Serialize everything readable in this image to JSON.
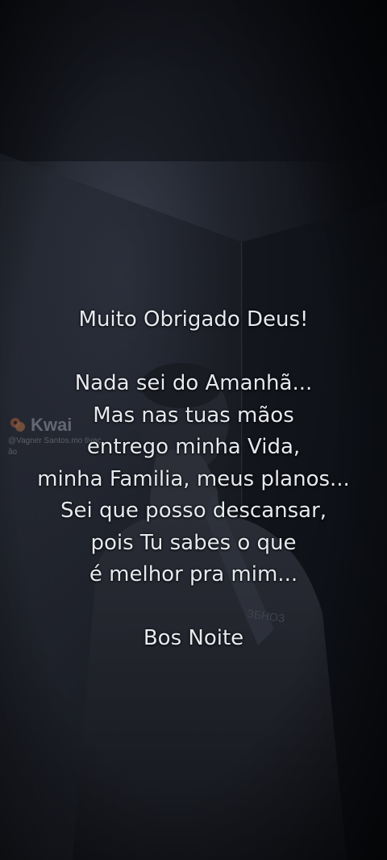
{
  "watermark": {
    "brand": "Kwai",
    "handle": "@Vagner Santos.mo tivação",
    "logo_icon": "kwai-logo-icon"
  },
  "quote": {
    "heading": "Muito Obrigado Deus!",
    "lines": [
      "Nada sei do Amanhã...",
      "Mas nas tuas mãos",
      "entrego minha Vida,",
      "minha Familia, meus planos...",
      "Sei que posso descansar,",
      "pois Tu sabes o que",
      "é melhor pra mim..."
    ],
    "closing": "Bos Noite"
  },
  "colors": {
    "background": "#0e1016",
    "text": "#e6e9ee"
  }
}
